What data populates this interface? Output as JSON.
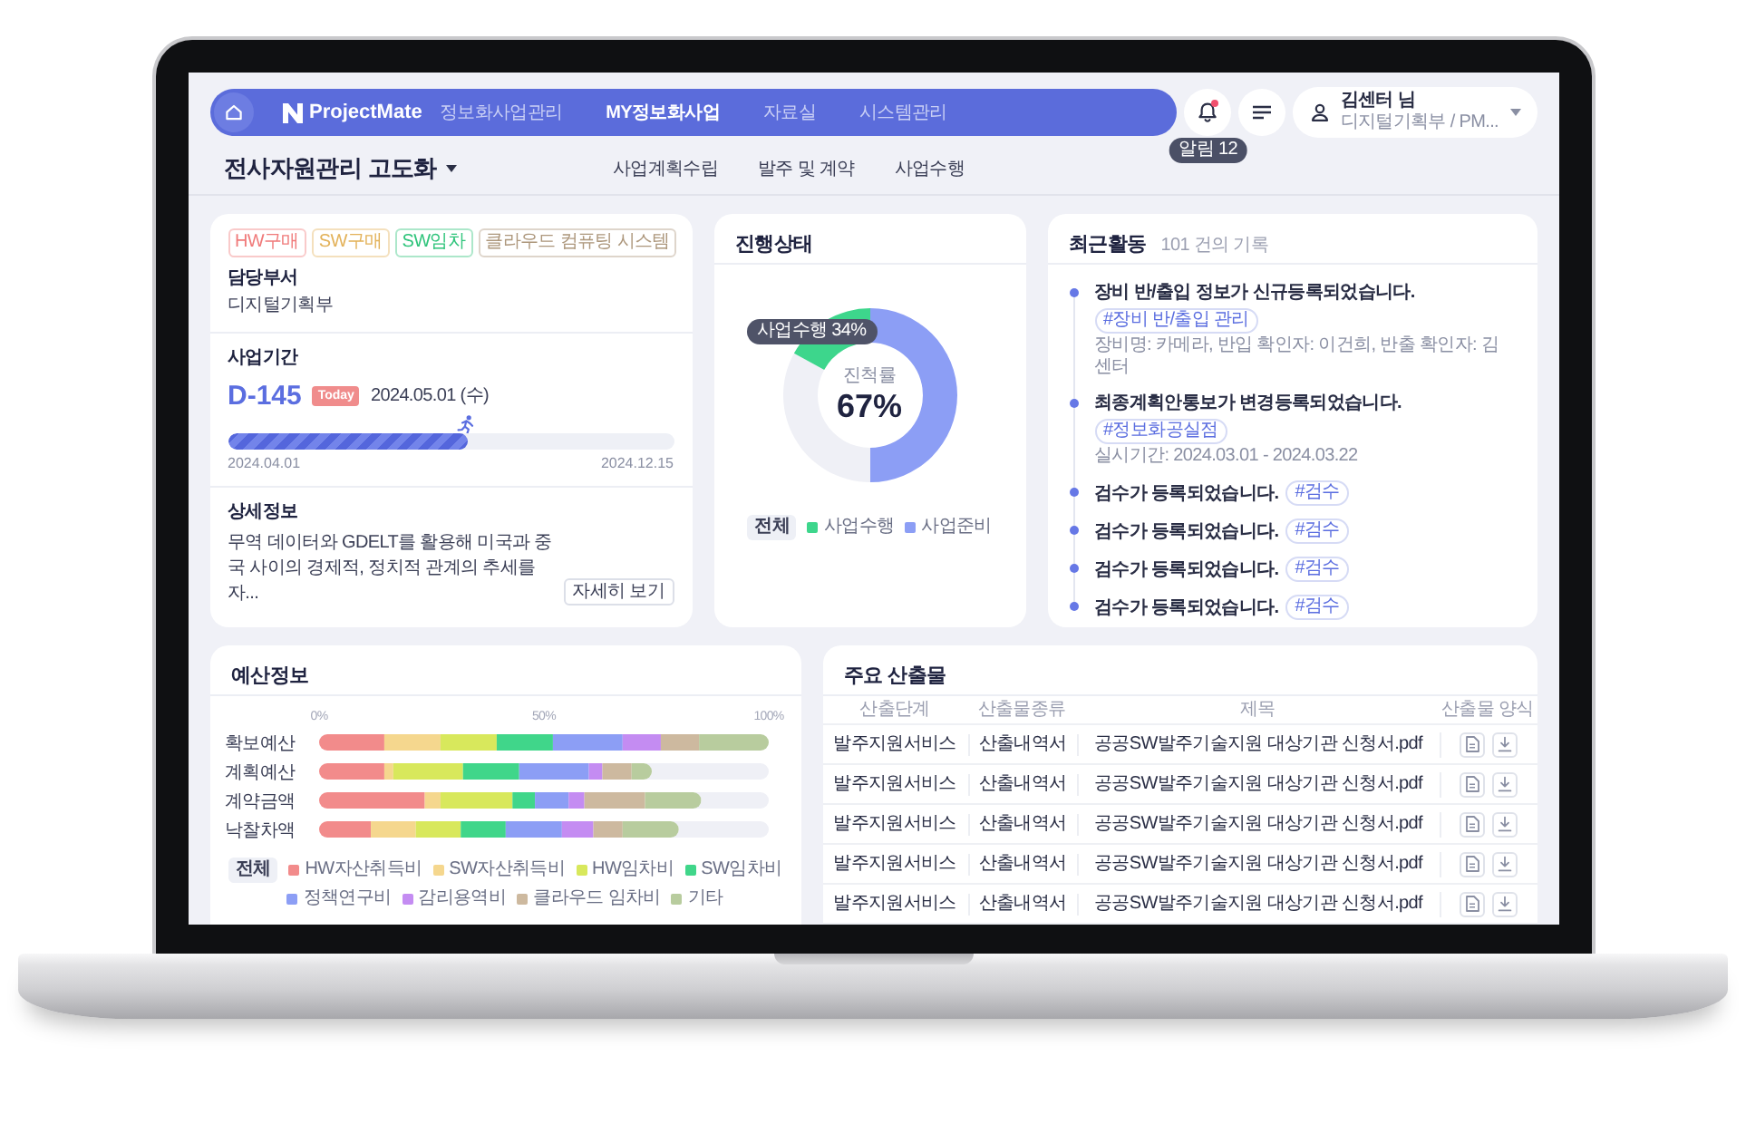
{
  "nav": {
    "logo": "ProjectMate",
    "items": [
      {
        "label": "정보화사업관리",
        "selected": false
      },
      {
        "label": "MY정보화사업",
        "selected": true
      },
      {
        "label": "자료실",
        "selected": false
      },
      {
        "label": "시스템관리",
        "selected": false
      }
    ],
    "notifications": {
      "badge": "알림 12",
      "unread": true
    },
    "user": {
      "name": "김센터 님",
      "department": "디지털기획부 / PM..."
    }
  },
  "project": {
    "title": "전사자원관리 고도화",
    "tabs": [
      {
        "label": "사업계획수립",
        "selected": false
      },
      {
        "label": "발주 및 계약",
        "selected": false
      },
      {
        "label": "사업수행",
        "selected": false
      }
    ]
  },
  "summary": {
    "tags": [
      {
        "label": "HW구매",
        "color": "#f07a7a"
      },
      {
        "label": "SW구매",
        "color": "#e3b25a"
      },
      {
        "label": "SW임차",
        "color": "#2fc47b"
      },
      {
        "label": "클라우드 컴퓨팅 시스템",
        "color": "#ad977c"
      }
    ],
    "department_label": "담당부서",
    "department": "디지털기획부",
    "period_label": "사업기간",
    "dday": "D-145",
    "today_badge": "Today",
    "today": "2024.05.01 (수)",
    "progress": {
      "level": 0.54
    },
    "start": "2024.04.01",
    "end": "2024.12.15",
    "detail_label": "상세정보",
    "detail": "무역 데이터와 GDELT를 활용해 미국과 중국 사이의 경제적, 정치적 관계의 추세를 자...",
    "more_button": "자세히 보기"
  },
  "status": {
    "title": "진행상태",
    "tooltip": "사업수행 34%",
    "center_label": "진척률",
    "center_value": "67%",
    "legend": [
      {
        "label": "전체",
        "kind": "all"
      },
      {
        "label": "사업수행",
        "kind": "series",
        "color": "#3dd68c",
        "level": 0.17
      },
      {
        "label": "사업준비",
        "kind": "series",
        "color": "#8c9ef5",
        "level": 0.5
      }
    ]
  },
  "activity": {
    "title": "최근활동",
    "count": "101 건의 기록",
    "items": [
      {
        "text": "장비 반/출입 정보가 신규등록되었습니다.",
        "tag": "#장비 반/출입 관리",
        "detail": "장비명: 카메라, 반입 확인자: 이건희, 반출 확인자: 김센터"
      },
      {
        "text": "최종계획안통보가 변경등록되었습니다.",
        "tag": "#정보화공실점",
        "detail": "실시기간: 2024.03.01 - 2024.03.22"
      },
      {
        "text": "검수가 등록되었습니다.",
        "tag": "#검수"
      },
      {
        "text": "검수가 등록되었습니다.",
        "tag": "#검수"
      },
      {
        "text": "검수가 등록되었습니다.",
        "tag": "#검수"
      },
      {
        "text": "검수가 등록되었습니다.",
        "tag": "#검수"
      }
    ]
  },
  "budget": {
    "title": "예산정보",
    "legend_all": "전체",
    "chart_data": {
      "type": "bar",
      "orientation": "horizontal",
      "stacked": true,
      "categories": [
        "확보예산",
        "계획예산",
        "계약금액",
        "낙찰차액"
      ],
      "xlim": [
        0,
        1
      ],
      "xticks": [
        {
          "value": 0,
          "label": "0%"
        },
        {
          "value": 0.5,
          "label": "50%"
        },
        {
          "value": 1,
          "label": "100%"
        }
      ],
      "series": [
        {
          "name": "HW자산취득비",
          "color": "#f28b8b",
          "values": [
            0.145,
            0.145,
            0.235,
            0.115
          ]
        },
        {
          "name": "SW자산취득비",
          "color": "#f5d78e",
          "values": [
            0.125,
            0.02,
            0.035,
            0.1
          ]
        },
        {
          "name": "HW임차비",
          "color": "#d8e85c",
          "values": [
            0.125,
            0.155,
            0.16,
            0.1
          ]
        },
        {
          "name": "SW임차비",
          "color": "#40d68a",
          "values": [
            0.125,
            0.125,
            0.05,
            0.1
          ]
        },
        {
          "name": "정책연구비",
          "color": "#8c9ef5",
          "values": [
            0.155,
            0.155,
            0.075,
            0.125
          ]
        },
        {
          "name": "감리용역비",
          "color": "#c48cf2",
          "values": [
            0.085,
            0.03,
            0.035,
            0.07
          ]
        },
        {
          "name": "클라우드 임차비",
          "color": "#cdb99f",
          "values": [
            0.085,
            0.065,
            0.135,
            0.065
          ]
        },
        {
          "name": "기타",
          "color": "#b8cc9e",
          "values": [
            0.155,
            0.045,
            0.125,
            0.125
          ]
        }
      ]
    }
  },
  "outputs": {
    "title": "주요 산출물",
    "columns": [
      "산출단계",
      "산출물종류",
      "제목",
      "산출물 양식"
    ],
    "rows": [
      {
        "stage": "발주지원서비스",
        "type": "산출내역서",
        "title": "공공SW발주기술지원 대상기관 신청서.pdf"
      },
      {
        "stage": "발주지원서비스",
        "type": "산출내역서",
        "title": "공공SW발주기술지원 대상기관 신청서.pdf"
      },
      {
        "stage": "발주지원서비스",
        "type": "산출내역서",
        "title": "공공SW발주기술지원 대상기관 신청서.pdf"
      },
      {
        "stage": "발주지원서비스",
        "type": "산출내역서",
        "title": "공공SW발주기술지원 대상기관 신청서.pdf"
      },
      {
        "stage": "발주지원서비스",
        "type": "산출내역서",
        "title": "공공SW발주기술지원 대상기관 신청서.pdf"
      }
    ]
  }
}
